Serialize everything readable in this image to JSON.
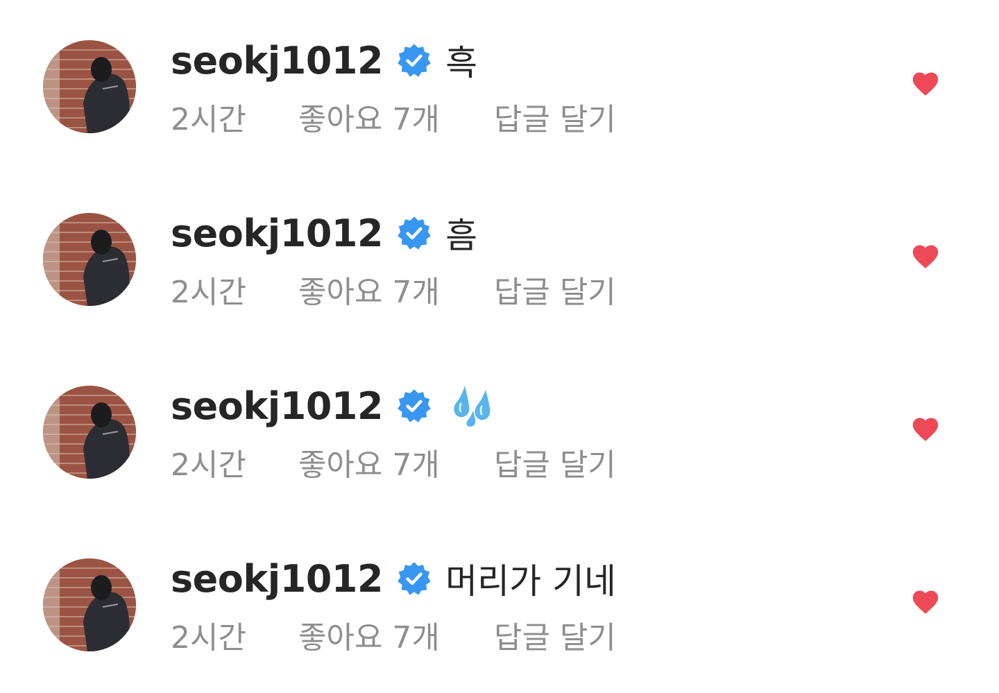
{
  "colors": {
    "text_primary": "#262626",
    "text_secondary": "#8e8e8e",
    "verified_blue": "#3897f0",
    "heart_red": "#ed4956"
  },
  "comments": [
    {
      "username": "seokj1012",
      "verified": true,
      "text": "흑",
      "time": "2시간",
      "likes": "좋아요 7개",
      "reply": "답글 달기",
      "liked": true
    },
    {
      "username": "seokj1012",
      "verified": true,
      "text": "흠",
      "time": "2시간",
      "likes": "좋아요 7개",
      "reply": "답글 달기",
      "liked": true
    },
    {
      "username": "seokj1012",
      "verified": true,
      "text": "",
      "emoji": "sweat-droplets-icon",
      "time": "2시간",
      "likes": "좋아요 7개",
      "reply": "답글 달기",
      "liked": true
    },
    {
      "username": "seokj1012",
      "verified": true,
      "text": "머리가 기네",
      "time": "2시간",
      "likes": "좋아요 7개",
      "reply": "답글 달기",
      "liked": true
    }
  ]
}
